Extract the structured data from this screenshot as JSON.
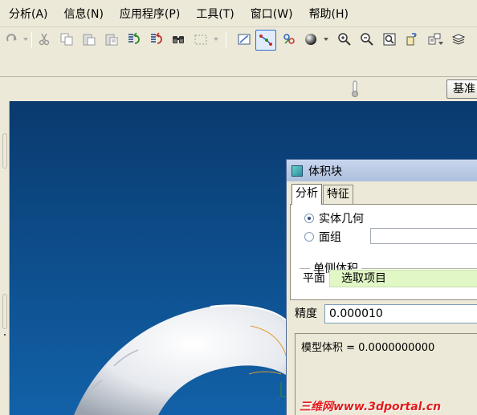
{
  "menu": [
    "分析(A)",
    "信息(N)",
    "应用程序(P)",
    "工具(T)",
    "窗口(W)",
    "帮助(H)"
  ],
  "toolbar": {
    "icons": [
      "redo-icon",
      "cut-icon",
      "copy-icon",
      "paste-icon",
      "paste-special-icon",
      "regenerate-icon",
      "regen-manager-icon",
      "find-icon",
      "select-box-icon",
      "datum-display-icon",
      "datum-axes-icon",
      "spin-center-icon",
      "shading-icon",
      "zoom-in-icon",
      "zoom-out-icon",
      "refit-icon",
      "reorient-icon",
      "saved-views-icon",
      "layers-icon"
    ],
    "pressed": "datum-axes-icon"
  },
  "band": {
    "datum_button": "基准"
  },
  "dialog": {
    "title": "体积块",
    "tabs": [
      "分析",
      "特征"
    ],
    "active_tab": "分析",
    "options": [
      {
        "label": "实体几何",
        "selected": true
      },
      {
        "label": "面组",
        "selected": false
      }
    ],
    "surface_value": "",
    "group_label": "单侧体积",
    "plane_label": "平面",
    "plane_value": "选取项目",
    "precision_label": "精度",
    "precision_value": "0.000010",
    "result": "模型体积 = 0.0000000000"
  },
  "watermark": "三维网www.3dportal.cn",
  "colors": {
    "viewport_top": "#0a3a6e",
    "viewport_bottom": "#1261a8",
    "plane_field": "#e1f7c6",
    "watermark": "#e31b1b"
  }
}
